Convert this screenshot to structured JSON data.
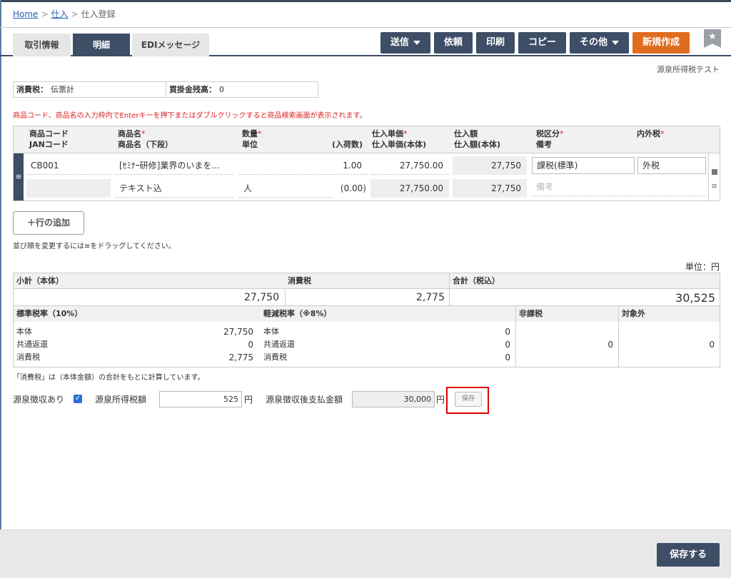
{
  "breadcrumb": {
    "home": "Home",
    "purchase": "仕入",
    "current": "仕入登録",
    "sep": ">"
  },
  "tabs": [
    {
      "label": "取引情報"
    },
    {
      "label": "明細"
    },
    {
      "label": "EDIメッセージ"
    }
  ],
  "toolbar": {
    "send": "送信",
    "request": "依頼",
    "print": "印刷",
    "copy": "コピー",
    "other": "その他",
    "new": "新規作成",
    "star": "★"
  },
  "source_test": "源泉所得税テスト",
  "info": {
    "tax_label": "消費税：",
    "tax_value": "伝票計",
    "balance_label": "買掛金残高：",
    "balance_value": "0"
  },
  "notice": "商品コード、商品名の入力枠内でEnterキーを押下またはダブルクリックすると商品検索画面が表示されます。",
  "grid": {
    "headers": {
      "code": "商品コード",
      "jan": "JANコード",
      "name": "商品名",
      "name_sub": "商品名（下段）",
      "qty": "数量",
      "unit": "単位",
      "in_qty": "(入荷数)",
      "price": "仕入単価",
      "price_body": "仕入単価(本体)",
      "amount": "仕入額",
      "amount_body": "仕入額(本体)",
      "tax_class": "税区分",
      "note": "備考",
      "tax_type": "内外税"
    },
    "required_mark": "*",
    "row": {
      "code": "CB001",
      "name": "[ｾﾐﾅｰ研修]業界のいまを...",
      "name_sub": "テキスト込",
      "qty": "1.00",
      "unit": "人",
      "in_qty": "(0.00)",
      "price": "27,750.00",
      "price_body": "27,750.00",
      "amount": "27,750",
      "amount_body": "27,750",
      "tax_class": "課税(標準)",
      "tax_type": "外税",
      "note_placeholder": "備考",
      "drag": "≡",
      "menu": "≡"
    }
  },
  "add_row": "＋行の追加",
  "drag_hint": "並び順を変更するには≡をドラッグしてください。",
  "unit_label": "単位：円",
  "totals": {
    "subtotal_label": "小計（本体）",
    "tax_label": "消費税",
    "total_label": "合計（税込）",
    "subtotal": "27,750",
    "tax": "2,775",
    "total": "30,525"
  },
  "rates": {
    "std_label": "標準税率（10%）",
    "reduced_label": "軽減税率（※8%）",
    "nontax_label": "非課税",
    "exempt_label": "対象外",
    "body": "本体",
    "rebate": "共通返還",
    "tax": "消費税",
    "std_body": "27,750",
    "std_rebate": "0",
    "std_tax": "2,775",
    "red_body": "0",
    "red_rebate": "0",
    "red_tax": "0",
    "nontax": "0",
    "exempt": "0"
  },
  "calc_note": "「消費税」は（本体金額）の合計をもとに計算しています。",
  "withholding": {
    "label": "源泉徴収あり",
    "checked": "✓",
    "tax_label": "源泉所得税額",
    "tax_value": "525",
    "yen": "円",
    "after_label": "源泉徴収後支払金額",
    "after_value": "30,000",
    "save": "保存"
  },
  "footer_save": "保存する"
}
